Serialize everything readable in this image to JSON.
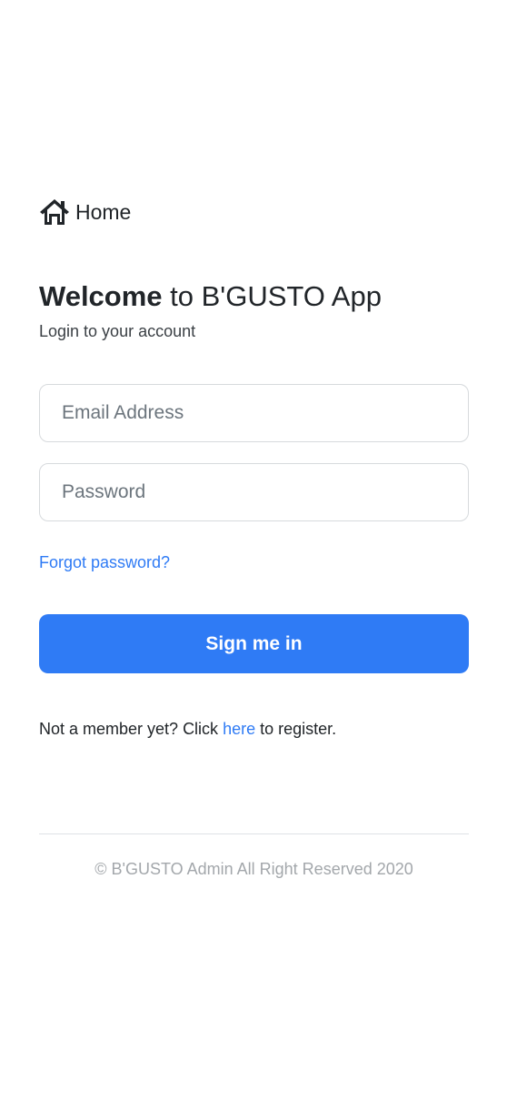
{
  "nav": {
    "home_label": "Home",
    "home_icon": "home-icon"
  },
  "header": {
    "welcome_bold": "Welcome",
    "welcome_rest": " to B'GUSTO App",
    "subtitle": "Login to your account"
  },
  "form": {
    "email_placeholder": "Email Address",
    "email_value": "",
    "password_placeholder": "Password",
    "password_value": "",
    "forgot_label": "Forgot password?",
    "submit_label": "Sign me in"
  },
  "register": {
    "prefix": "Not a member yet? Click ",
    "link_label": "here",
    "suffix": " to register."
  },
  "footer": {
    "copyright": "© B'GUSTO Admin All Right Reserved 2020"
  },
  "colors": {
    "accent": "#2f7bf5",
    "text": "#212529",
    "muted": "#a3a7ab",
    "border": "#d7dadd"
  }
}
